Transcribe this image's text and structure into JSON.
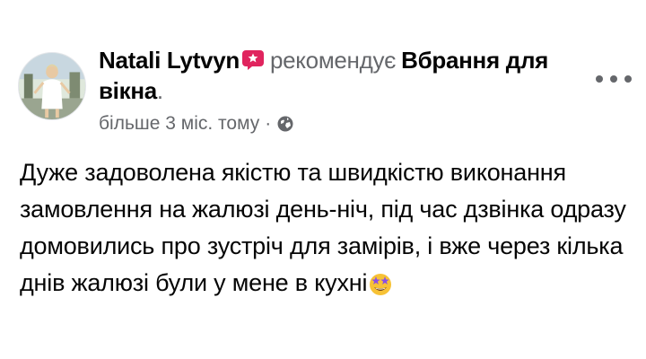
{
  "post": {
    "author": "Natali Lytvyn",
    "recommends_text": "рекомендує",
    "page_name": "Вбрання для вікна",
    "period": ".",
    "timestamp": "більше 3 міс. тому",
    "separator": "·",
    "audience_icon": "globe-icon",
    "author_badge_icon": "recommendation-badge-icon",
    "more_icon": "more-options-icon",
    "text": "Дуже задоволена якістю та швидкістю виконання замовлення на жалюзі день-ніч, під час дзвінка одразу домовились про зустріч для замірів, і вже через кілька днів жалюзі були у мене в кухні",
    "emoji": "star-struck-emoji",
    "colors": {
      "text": "#050505",
      "secondary": "#65676b",
      "badge": "#e0245e",
      "emoji_face": "#f7c235",
      "emoji_stars": "#8a4fe6"
    }
  }
}
